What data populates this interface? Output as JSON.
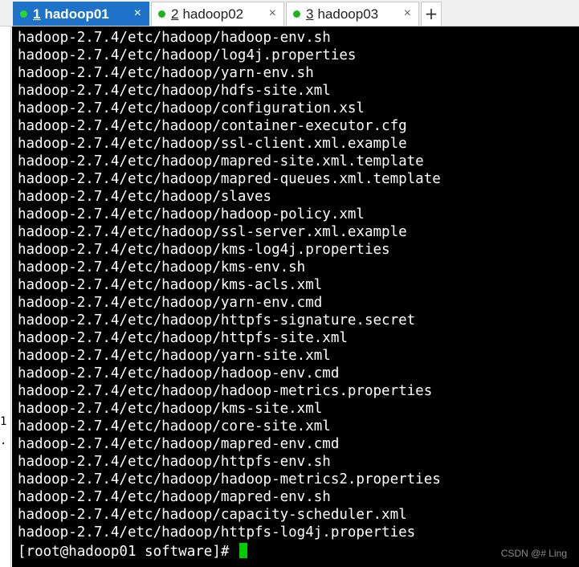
{
  "tabs": [
    {
      "number": "1",
      "label": "hadoop01",
      "close": "×",
      "active": true
    },
    {
      "number": "2",
      "label": "hadoop02",
      "close": "×",
      "active": false
    },
    {
      "number": "3",
      "label": "hadoop03",
      "close": "×",
      "active": false
    }
  ],
  "add_tab": "+",
  "left_pane_chars": [
    "1",
    "."
  ],
  "terminal": {
    "lines": [
      "hadoop-2.7.4/etc/hadoop/hadoop-env.sh",
      "hadoop-2.7.4/etc/hadoop/log4j.properties",
      "hadoop-2.7.4/etc/hadoop/yarn-env.sh",
      "hadoop-2.7.4/etc/hadoop/hdfs-site.xml",
      "hadoop-2.7.4/etc/hadoop/configuration.xsl",
      "hadoop-2.7.4/etc/hadoop/container-executor.cfg",
      "hadoop-2.7.4/etc/hadoop/ssl-client.xml.example",
      "hadoop-2.7.4/etc/hadoop/mapred-site.xml.template",
      "hadoop-2.7.4/etc/hadoop/mapred-queues.xml.template",
      "hadoop-2.7.4/etc/hadoop/slaves",
      "hadoop-2.7.4/etc/hadoop/hadoop-policy.xml",
      "hadoop-2.7.4/etc/hadoop/ssl-server.xml.example",
      "hadoop-2.7.4/etc/hadoop/kms-log4j.properties",
      "hadoop-2.7.4/etc/hadoop/kms-env.sh",
      "hadoop-2.7.4/etc/hadoop/kms-acls.xml",
      "hadoop-2.7.4/etc/hadoop/yarn-env.cmd",
      "hadoop-2.7.4/etc/hadoop/httpfs-signature.secret",
      "hadoop-2.7.4/etc/hadoop/httpfs-site.xml",
      "hadoop-2.7.4/etc/hadoop/yarn-site.xml",
      "hadoop-2.7.4/etc/hadoop/hadoop-env.cmd",
      "hadoop-2.7.4/etc/hadoop/hadoop-metrics.properties",
      "hadoop-2.7.4/etc/hadoop/kms-site.xml",
      "hadoop-2.7.4/etc/hadoop/core-site.xml",
      "hadoop-2.7.4/etc/hadoop/mapred-env.cmd",
      "hadoop-2.7.4/etc/hadoop/httpfs-env.sh",
      "hadoop-2.7.4/etc/hadoop/hadoop-metrics2.properties",
      "hadoop-2.7.4/etc/hadoop/mapred-env.sh",
      "hadoop-2.7.4/etc/hadoop/capacity-scheduler.xml",
      "hadoop-2.7.4/etc/hadoop/httpfs-log4j.properties"
    ],
    "prompt": "[root@hadoop01 software]# ",
    "cursor_color": "#00cc00"
  },
  "watermark": "CSDN @#  Ling",
  "colors": {
    "active_tab": "#1e73c8",
    "status_dot": "#1db31d",
    "terminal_bg": "#000000",
    "terminal_fg": "#ffffff"
  }
}
